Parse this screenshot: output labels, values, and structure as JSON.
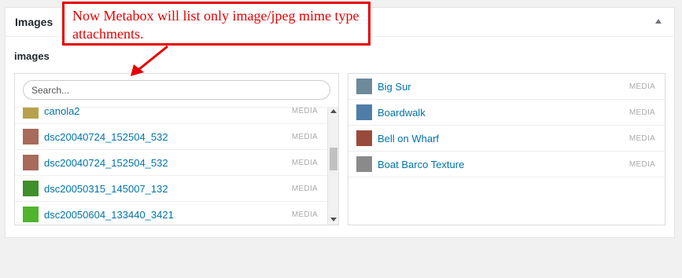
{
  "metabox": {
    "title": "Images",
    "field_label": "images"
  },
  "search": {
    "placeholder": "Search..."
  },
  "left_list": [
    {
      "title": "canola2",
      "type": "MEDIA",
      "thumb_color": "#b8a14a"
    },
    {
      "title": "dsc20040724_152504_532",
      "type": "MEDIA",
      "thumb_color": "#a86a5a"
    },
    {
      "title": "dsc20040724_152504_532",
      "type": "MEDIA",
      "thumb_color": "#a86a5a"
    },
    {
      "title": "dsc20050315_145007_132",
      "type": "MEDIA",
      "thumb_color": "#3f8f2a"
    },
    {
      "title": "dsc20050604_133440_3421",
      "type": "MEDIA",
      "thumb_color": "#4fb52d"
    }
  ],
  "right_list": [
    {
      "title": "Big Sur",
      "type": "MEDIA",
      "thumb_color": "#6d8a9a"
    },
    {
      "title": "Boardwalk",
      "type": "MEDIA",
      "thumb_color": "#4e7ea8"
    },
    {
      "title": "Bell on Wharf",
      "type": "MEDIA",
      "thumb_color": "#9a4a3a"
    },
    {
      "title": "Boat Barco Texture",
      "type": "MEDIA",
      "thumb_color": "#8a8a8a"
    }
  ],
  "annotation": {
    "text": "Now Metabox will list only image/jpeg mime type attachments.",
    "color": "#e60000"
  }
}
